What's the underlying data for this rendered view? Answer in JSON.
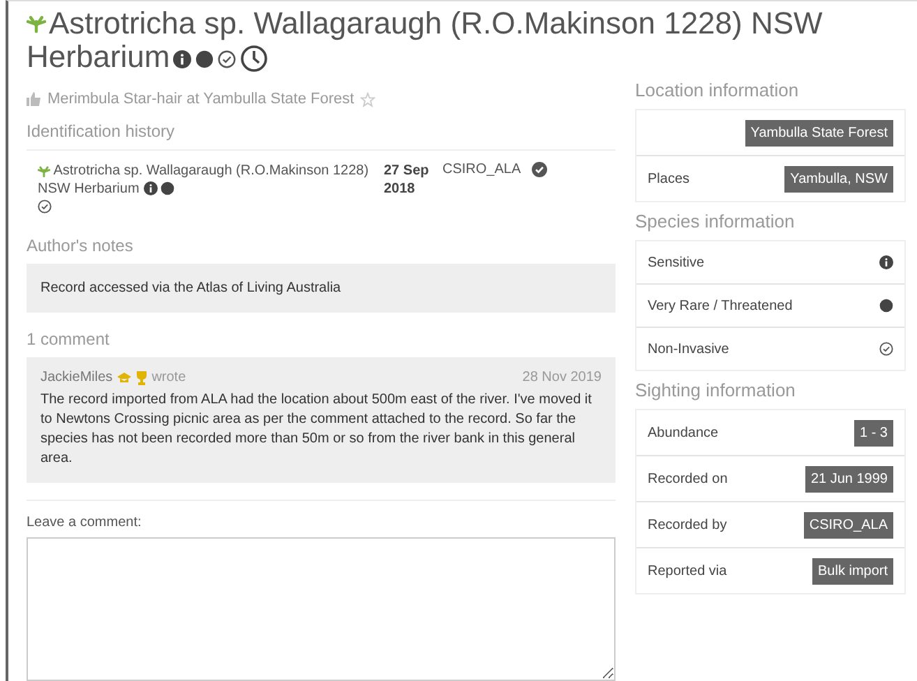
{
  "title": {
    "line1": "Astrotricha sp. Wallagaraugh (R.O.Makinson 1228) NSW",
    "line2": "Herbarium"
  },
  "common_name": "Merimbula Star-hair at Yambulla State Forest",
  "identification_history": {
    "heading": "Identification history",
    "rows": [
      {
        "name": "Astrotricha sp. Wallagaraugh (R.O.Makinson 1228) NSW Herbarium",
        "date": "27 Sep 2018",
        "by": "CSIRO_ALA"
      }
    ]
  },
  "authors_notes": {
    "heading": "Author's notes",
    "text": "Record accessed via the Atlas of Living Australia"
  },
  "comments": {
    "heading": "1 comment",
    "items": [
      {
        "author": "JackieMiles",
        "verb": "wrote",
        "date": "28 Nov 2019",
        "text": "The record imported from ALA had the location about 500m east of the river. I've moved it to Newtons Crossing picnic area as per the comment attached to the record. So far the species has not been recorded more than 50m or so from the river bank in this general area."
      }
    ]
  },
  "leave_comment": {
    "label": "Leave a comment:"
  },
  "location_information": {
    "heading": "Location information",
    "rows": [
      {
        "label": "",
        "value": "Yambulla State Forest"
      },
      {
        "label": "Places",
        "value": "Yambulla, NSW"
      }
    ]
  },
  "species_information": {
    "heading": "Species information",
    "rows": [
      {
        "label": "Sensitive",
        "kind": "info"
      },
      {
        "label": "Very Rare / Threatened",
        "kind": "dot"
      },
      {
        "label": "Non-Invasive",
        "kind": "check"
      }
    ]
  },
  "sighting_information": {
    "heading": "Sighting information",
    "rows": [
      {
        "label": "Abundance",
        "value": "1 - 3"
      },
      {
        "label": "Recorded on",
        "value": "21 Jun 1999"
      },
      {
        "label": "Recorded by",
        "value": "CSIRO_ALA"
      },
      {
        "label": "Reported via",
        "value": "Bulk import"
      }
    ]
  }
}
